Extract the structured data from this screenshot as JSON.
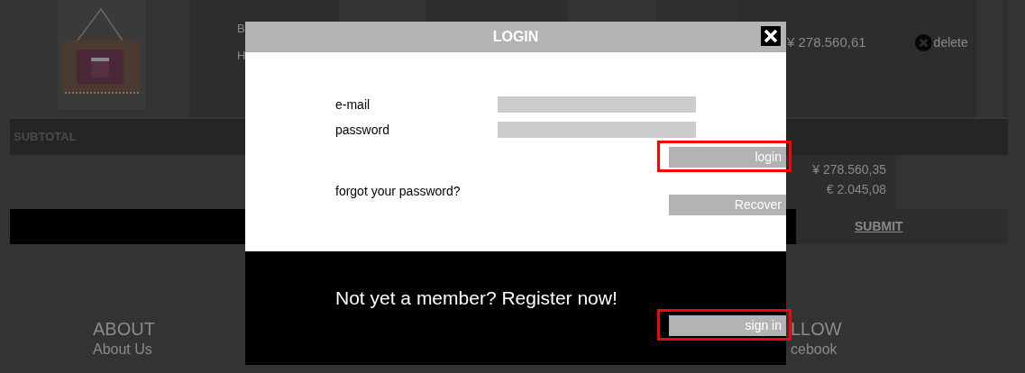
{
  "cart": {
    "row": {
      "column_2": [
        "B",
        "H"
      ],
      "price": "¥ 278.560,61",
      "delete_label": "delete"
    },
    "subtotal_label": "SUBTOTAL",
    "totals": [
      "¥ 278.560,35",
      "€ 2.045,08"
    ],
    "submit": "SUBMIT"
  },
  "footer": {
    "columns": [
      {
        "heading": "ABOUT",
        "links": [
          "About Us"
        ]
      },
      {
        "heading": "LLOW",
        "links": [
          "cebook"
        ]
      }
    ]
  },
  "login_dialog": {
    "title": "LOGIN",
    "fields": [
      {
        "label": "e-mail"
      },
      {
        "label": "password"
      }
    ],
    "login_button": {
      "label": "login",
      "highlighted": true
    },
    "forgot_text": "forgot your password?",
    "recover_button": {
      "label": "Recover",
      "highlighted": false
    },
    "register_text": "Not yet a member? Register now!",
    "sign_in_button": {
      "label": "sign in",
      "highlighted": true
    }
  }
}
